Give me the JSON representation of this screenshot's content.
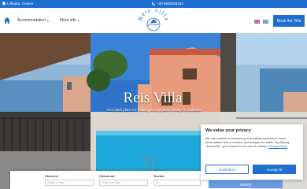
{
  "topbar": {
    "location": "Lefkada, Greece",
    "phone": "+30 6945254444"
  },
  "nav": {
    "items": [
      {
        "label": "Accommodation"
      },
      {
        "label": "More info"
      }
    ],
    "logo_text": "Reis Villa",
    "book_label": "Book the Villa"
  },
  "hero": {
    "title": "Reis Villa",
    "subtitle": "Your ideal place for relaxing & enjoyable holidays in Lefkada"
  },
  "search": {
    "checkin_label": "Check-in",
    "checkin_placeholder": "Check-in Date",
    "checkout_label": "Check-out",
    "checkout_placeholder": "Check-out Date",
    "guests_label": "Guests",
    "guests_value": "1",
    "search_label": "Search"
  },
  "cookie": {
    "title": "We value your privacy",
    "body": "We use cookies to enhance your browsing experience, serve personalized ads or content, and analyze our traffic. By clicking \"Accept All\", you consent to our use of cookies.",
    "policy_link": "Privacy Policy",
    "customize_label": "Customize",
    "accept_label": "Accept All"
  },
  "colors": {
    "brand_blue": "#1e6fd0",
    "search_button": "#6a9ae0"
  }
}
